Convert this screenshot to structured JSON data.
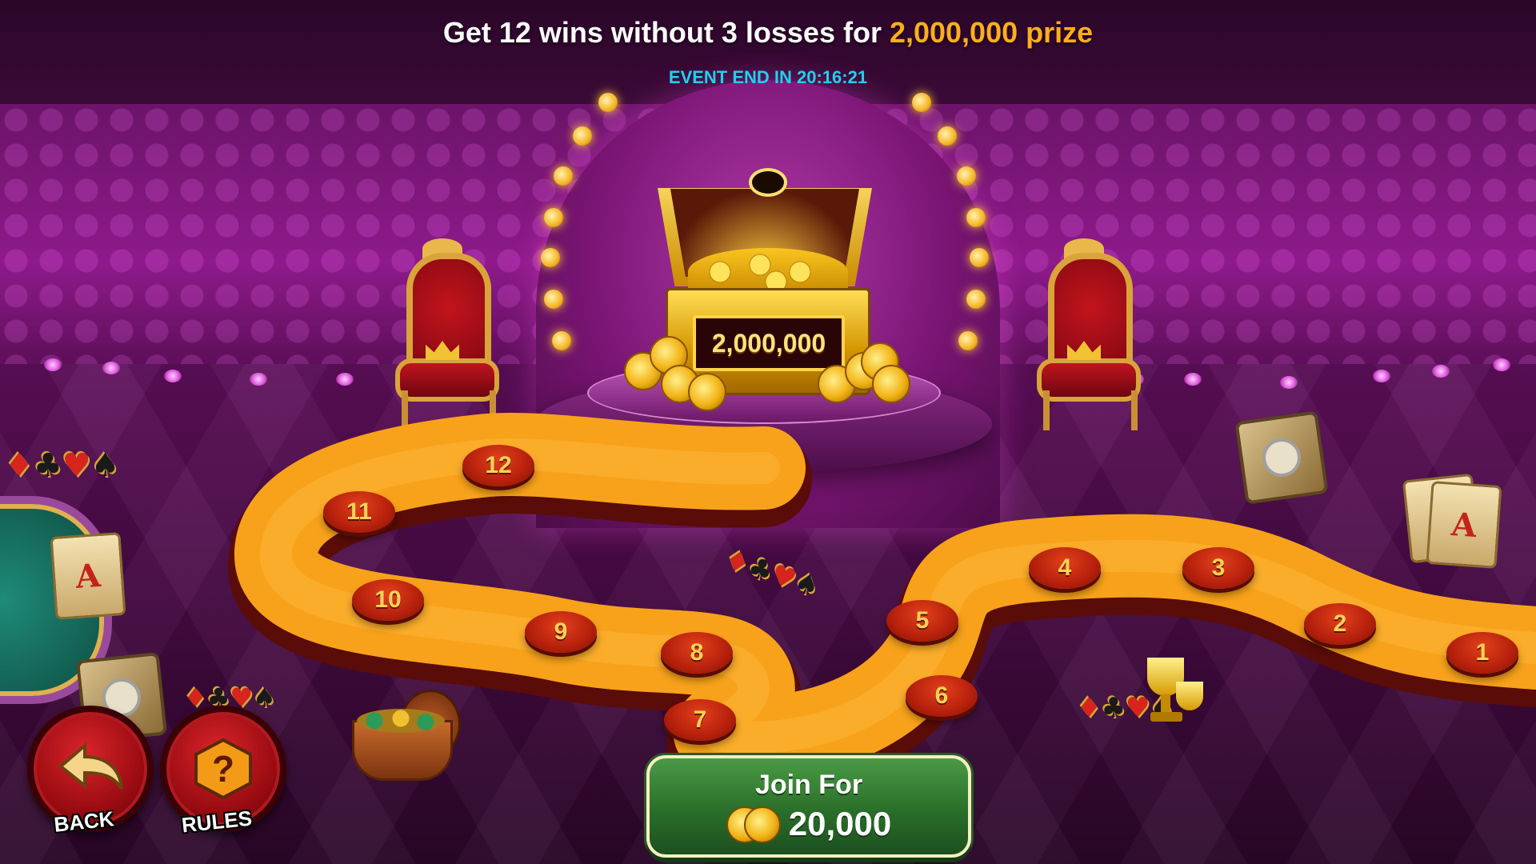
{
  "header": {
    "headline_prefix": "Get 12 wins without 3 losses for",
    "headline_prize": "2,000,000 prize",
    "timer": "EVENT END IN 20:16:21"
  },
  "chest": {
    "prize_amount": "2,000,000"
  },
  "path": {
    "stones": [
      "1",
      "2",
      "3",
      "4",
      "5",
      "6",
      "7",
      "8",
      "9",
      "10",
      "11",
      "12"
    ]
  },
  "decorations": {
    "card_letter": "A"
  },
  "join_button": {
    "label": "Join For",
    "price": "20,000"
  },
  "nav": {
    "back_label": "BACK",
    "rules_label": "RULES"
  },
  "colors": {
    "prize_accent": "#ffae1a",
    "timer": "#1fd0f0",
    "path": "#f7a21a",
    "stone": "#c8280e",
    "join_green": "#2a6e2a"
  }
}
